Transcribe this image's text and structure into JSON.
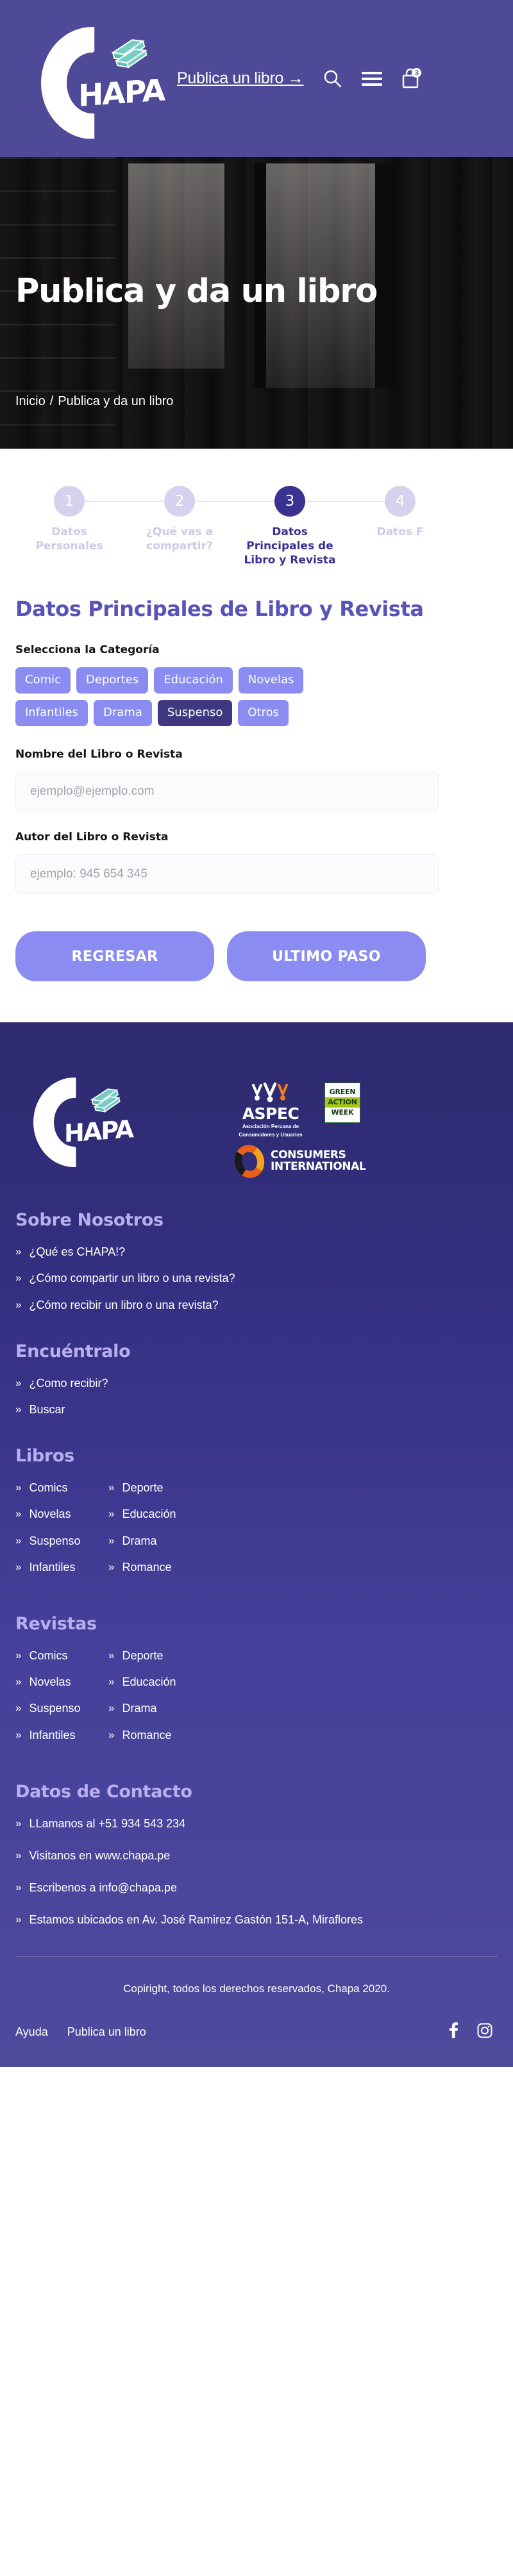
{
  "header": {
    "brand": {
      "word": "HAPA",
      "books_icon": "books-icon",
      "bang": "!"
    },
    "cta_label": "Publica un libro →",
    "search_icon": "search-icon",
    "menu_icon": "hamburger-menu-icon",
    "cart_icon": "shopping-bag-icon",
    "cart_count": "3",
    "bg_color": "#4e4a97"
  },
  "hero": {
    "title": "Publica y da un libro",
    "breadcrumb": {
      "home": "Inicio",
      "separator": "/",
      "current": "Publica y da un libro"
    }
  },
  "stepper": {
    "steps": [
      {
        "number": "1",
        "label": "Datos Personales",
        "active": false
      },
      {
        "number": "2",
        "label": "¿Qué vas a compartir?",
        "active": false
      },
      {
        "number": "3",
        "label": "Datos Principales de Libro y Revista",
        "active": true
      },
      {
        "number": "4",
        "label": "Datos F",
        "active": false
      }
    ]
  },
  "form": {
    "title": "Datos Principales de Libro y Revista",
    "category_label": "Selecciona la Categoría",
    "categories": [
      {
        "label": "Comic",
        "selected": false
      },
      {
        "label": "Deportes",
        "selected": false
      },
      {
        "label": "Educación",
        "selected": false
      },
      {
        "label": "Novelas",
        "selected": false
      },
      {
        "label": "Infantiles",
        "selected": false
      },
      {
        "label": "Drama",
        "selected": false
      },
      {
        "label": "Suspenso",
        "selected": true
      },
      {
        "label": "Otros",
        "selected": false
      }
    ],
    "name_field": {
      "label": "Nombre del Libro o Revista",
      "value": "",
      "placeholder": "ejemplo@ejemplo.com"
    },
    "author_field": {
      "label": "Autor del Libro o Revista",
      "value": "",
      "placeholder": "ejemplo: 945 654 345"
    },
    "back_button": "REGRESAR",
    "next_button": "ULTIMO PASO",
    "accent_color": "#8a8cf2",
    "selected_color": "#3f3880",
    "title_color": "#5952b8"
  },
  "footer": {
    "partners": {
      "aspec": {
        "name": "ASPEC",
        "sub_line1": "Asociación Peruana de",
        "sub_line2": "Consumidores y Usuarios"
      },
      "green_action_week": {
        "line1": "GREEN",
        "line2": "ACTION",
        "line3": "WEEK"
      },
      "consumers_international": {
        "line1": "CONSUMERS",
        "line2": "INTERNATIONAL"
      }
    },
    "sections": [
      {
        "heading": "Sobre Nosotros",
        "items": [
          "¿Qué es CHAPA!?",
          "¿Cómo compartir un libro o una revista?",
          "¿Cómo recibir un libro o una revista?"
        ]
      },
      {
        "heading": "Encuéntralo",
        "items": [
          "¿Como recibir?",
          "Buscar"
        ]
      }
    ],
    "libros": {
      "heading": "Libros",
      "col1": [
        "Comics",
        "Novelas",
        "Suspenso",
        "Infantiles"
      ],
      "col2": [
        "Deporte",
        "Educación",
        "Drama",
        "Romance"
      ]
    },
    "revistas": {
      "heading": "Revistas",
      "col1": [
        "Comics",
        "Novelas",
        "Suspenso",
        "Infantiles"
      ],
      "col2": [
        "Deporte",
        "Educación",
        "Drama",
        "Romance"
      ]
    },
    "contacto": {
      "heading": "Datos de Contacto",
      "items": [
        "LLamanos al +51 934 543 234",
        "Visitanos en www.chapa.pe",
        "Escribenos a info@chapa.pe",
        "Estamos ubicados en Av. José Ramirez Gastón 151-A, Miraflores"
      ]
    },
    "copyright": "Copiright, todos los derechos reservados, Chapa 2020.",
    "bottom_links": [
      "Ayuda",
      "Publica un libro"
    ],
    "social": [
      "facebook-icon",
      "instagram-icon"
    ],
    "heading_color": "#b9aff0",
    "bg_top_color": "#2d2a6e",
    "bg_bottom_color": "#4e4a9c"
  }
}
